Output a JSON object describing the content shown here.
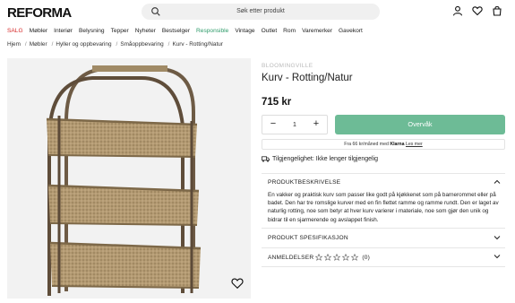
{
  "header": {
    "logo": "REFORMA",
    "search_placeholder": "Søk etter produkt"
  },
  "nav": [
    "SALG",
    "Møbler",
    "Interiør",
    "Belysning",
    "Tepper",
    "Nyheter",
    "Bestselger",
    "Responsible",
    "Vintage",
    "Outlet",
    "Rom",
    "Varemerker",
    "Gavekort"
  ],
  "breadcrumb": [
    "Hjem",
    "Møbler",
    "Hyller og oppbevaring",
    "Småoppbevaring",
    "Kurv - Rotting/Natur"
  ],
  "product": {
    "brand": "BLOOMINGVILLE",
    "title": "Kurv - Rotting/Natur",
    "price": "715 kr",
    "quantity": "1",
    "buy_label": "Overvåk",
    "klarna_prefix": "Fra 66 kr/måned med",
    "klarna_brand": "Klarna",
    "klarna_link": "Les mer",
    "availability": "Tilgjengelighet: Ikke lenger tilgjengelig"
  },
  "accordion": {
    "description_title": "PRODUKTBESKRIVELSE",
    "description_text": "En vakker og praktisk kurv som passer like godt på kjøkkenet som på barnerommet eller på badet. Den har tre romslige kurver med en fin flettet ramme og ramme rundt. Den er laget av naturlig rotting, noe som betyr at hver kurv varierer i materiale, noe som gjør den unik og bidrar til en sjarmerende og avslappet finish.",
    "spec_title": "PRODUKT SPESIFIKASJON",
    "reviews_title": "ANMELDELSER",
    "reviews_count": "(0)",
    "rating": 0
  },
  "colors": {
    "sale": "#d62828",
    "responsible": "#2e9b6a",
    "buy_button": "#6dbb96"
  }
}
